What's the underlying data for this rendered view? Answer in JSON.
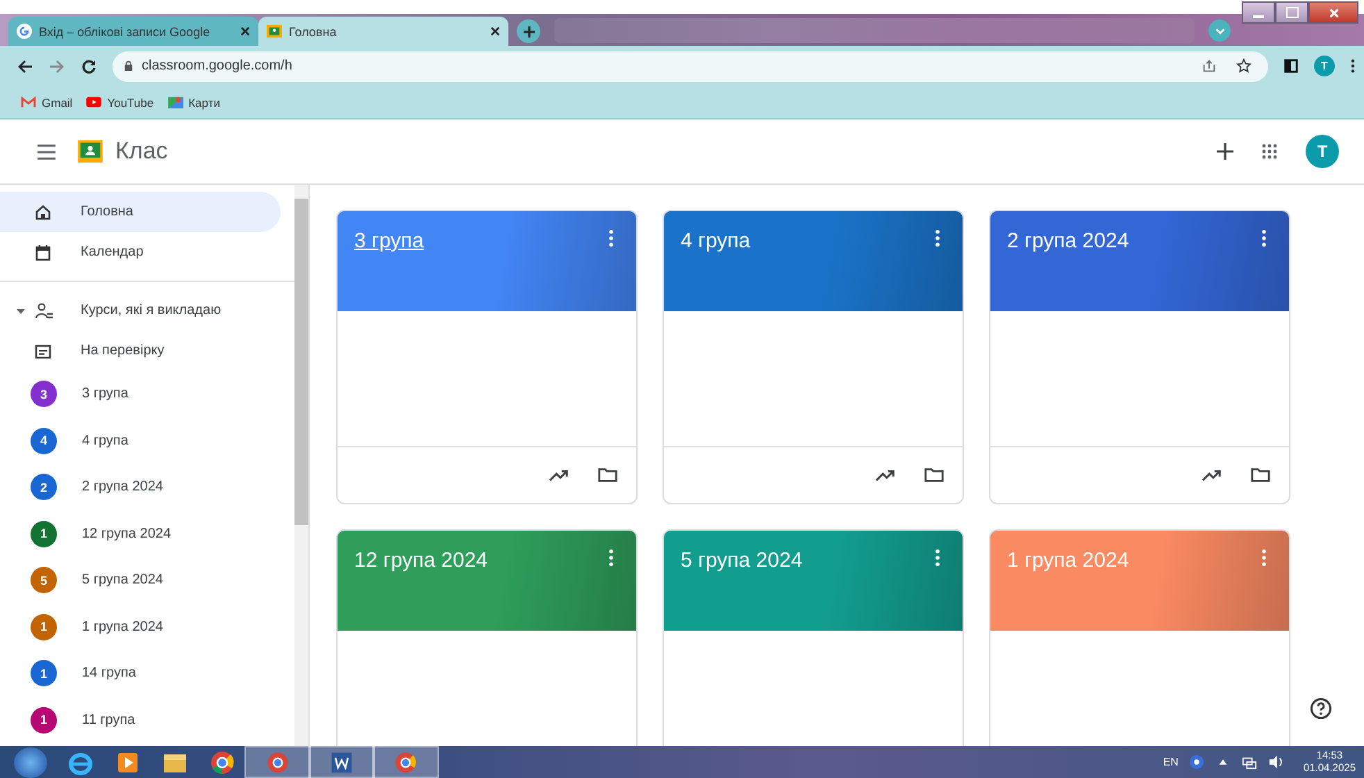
{
  "browser": {
    "tabs": [
      {
        "title": "Вхід – облікові записи Google",
        "selected": false
      },
      {
        "title": "Головна",
        "selected": true
      }
    ],
    "address": "classroom.google.com/h",
    "profile_letter": "T",
    "bookmarks": [
      {
        "label": "Gmail"
      },
      {
        "label": "YouTube"
      },
      {
        "label": "Карти"
      }
    ]
  },
  "app": {
    "title": "Клас",
    "avatar_letter": "T"
  },
  "sidebar": {
    "items": [
      {
        "kind": "nav",
        "label": "Головна",
        "selected": true
      },
      {
        "kind": "nav",
        "label": "Календар",
        "selected": false
      },
      {
        "kind": "divider"
      },
      {
        "kind": "section",
        "label": "Курси, які я викладаю",
        "expanded": true
      },
      {
        "kind": "nav",
        "label": "На перевірку",
        "selected": false
      },
      {
        "kind": "course",
        "label": "3 група",
        "letter": "3",
        "color": "#8430ce",
        "selected": false
      },
      {
        "kind": "course",
        "label": "4 група",
        "letter": "4",
        "color": "#1967d2",
        "selected": false
      },
      {
        "kind": "course",
        "label": "2 група 2024",
        "letter": "2",
        "color": "#1967d2",
        "selected": false
      },
      {
        "kind": "course",
        "label": "12 група 2024",
        "letter": "1",
        "color": "#137333",
        "selected": false
      },
      {
        "kind": "course",
        "label": "5 група 2024",
        "letter": "5",
        "color": "#c26401",
        "selected": false
      },
      {
        "kind": "course",
        "label": "1 група 2024",
        "letter": "1",
        "color": "#c26401",
        "selected": false
      },
      {
        "kind": "course",
        "label": "14 група",
        "letter": "1",
        "color": "#1967d2",
        "selected": false
      },
      {
        "kind": "course",
        "label": "11 група",
        "letter": "1",
        "color": "#b80672",
        "selected": false
      }
    ]
  },
  "courses": [
    {
      "title": "3 група",
      "color": "#4285f4",
      "hovered": true
    },
    {
      "title": "4 група",
      "color": "#1a73c8",
      "hovered": false
    },
    {
      "title": "2 група 2024",
      "color": "#3367d6",
      "hovered": false
    },
    {
      "title": "12 група 2024",
      "color": "#2e9e5a",
      "hovered": false
    },
    {
      "title": "5 група 2024",
      "color": "#129e8f",
      "hovered": false
    },
    {
      "title": "1 група 2024",
      "color": "#fa8a62",
      "hovered": false
    }
  ],
  "taskbar": {
    "language": "EN",
    "time": "14:53",
    "date": "01.04.2025"
  }
}
